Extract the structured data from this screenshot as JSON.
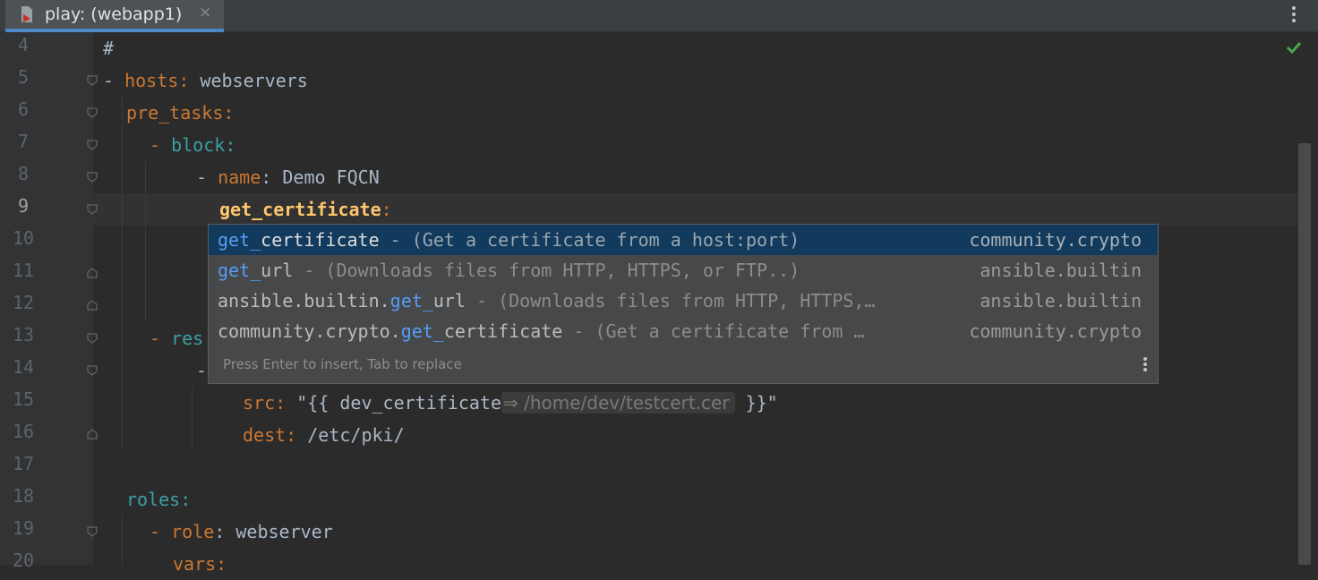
{
  "tab": {
    "title": "play: (webapp1)",
    "close": "×",
    "icon": "ansible-file-icon"
  },
  "line_numbers": [
    "4",
    "5",
    "6",
    "7",
    "8",
    "9",
    "10",
    "11",
    "12",
    "13",
    "14",
    "15",
    "16",
    "17",
    "18",
    "19",
    "20"
  ],
  "code": {
    "l4": "#",
    "l5_dash": "-",
    "l5_key": "hosts",
    "l5_colon": ":",
    "l5_val": "webservers",
    "l6_key": "pre_tasks",
    "l6_colon": ":",
    "l7_dash": "-",
    "l7_key": "block",
    "l7_colon": ":",
    "l8_dash": "-",
    "l8_key": "name",
    "l8_colon": ":",
    "l8_val": "Demo FQCN",
    "l9_key": "get_certificate",
    "l9_colon": ":",
    "l13_dash": "-",
    "l13_key": "res",
    "l14_dash": "-",
    "l15_key": "src",
    "l15_colon": ":",
    "l15_open": "\"{{",
    "l15_var": "dev_certificate",
    "l15_hint": "⇒ /home/dev/testcert.cer",
    "l15_close": "}}\"",
    "l16_key": "dest",
    "l16_colon": ":",
    "l16_val": "/etc/pki/",
    "l18_key": "roles",
    "l18_colon": ":",
    "l19_dash": "-",
    "l19_key": "role",
    "l19_colon": ":",
    "l19_val": "webserver",
    "l20_key": "vars",
    "l20_colon": ":"
  },
  "completion": {
    "items": [
      {
        "prefix": "",
        "match": "get_",
        "rest": "certificate",
        "desc": " - (Get a certificate from a host:port)",
        "source": "community.crypto"
      },
      {
        "prefix": "",
        "match": "get_",
        "rest": "url",
        "desc": " - (Downloads files from HTTP, HTTPS, or FTP..)",
        "source": "ansible.builtin"
      },
      {
        "prefix": "ansible.builtin.",
        "match": "get_",
        "rest": "url",
        "desc": " - (Downloads files from HTTP, HTTPS,…",
        "source": "ansible.builtin"
      },
      {
        "prefix": "community.crypto.",
        "match": "get_",
        "rest": "certificate",
        "desc": " - (Get a certificate from …",
        "source": "community.crypto"
      }
    ],
    "ad_text": "Press Enter to insert, Tab to replace"
  },
  "colors": {
    "keyword": "#cc7832",
    "teal_key": "#3d9fa5",
    "selection": "#113a5c",
    "match": "#589df6",
    "inspection_ok": "#4ca74c"
  }
}
